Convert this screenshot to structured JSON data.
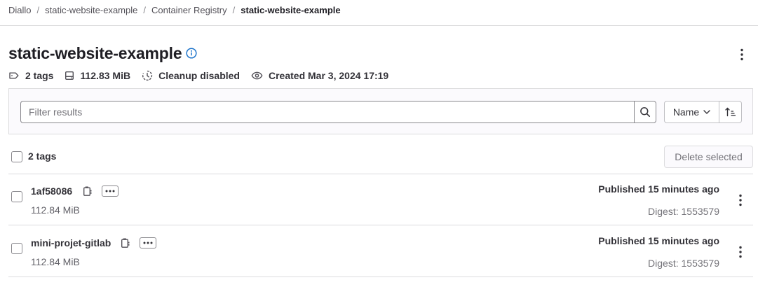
{
  "breadcrumb": {
    "items": [
      "Diallo",
      "static-website-example",
      "Container Registry"
    ],
    "separator": "/",
    "current": "static-website-example"
  },
  "header": {
    "title": "static-website-example",
    "info_icon": "info-icon",
    "actions_icon": "vertical-ellipsis-icon"
  },
  "meta": {
    "tags": "2 tags",
    "size": "112.83 MiB",
    "cleanup": "Cleanup disabled",
    "created": "Created Mar 3, 2024 17:19"
  },
  "filter": {
    "placeholder": "Filter results",
    "value": "",
    "sort_field": "Name"
  },
  "list": {
    "select_all_label": "2 tags",
    "delete_selected_label": "Delete selected",
    "rows": [
      {
        "name": "1af58086",
        "size": "112.84 MiB",
        "published": "Published 15 minutes ago",
        "digest": "Digest: 1553579"
      },
      {
        "name": "mini-projet-gitlab",
        "size": "112.84 MiB",
        "published": "Published 15 minutes ago",
        "digest": "Digest: 1553579"
      }
    ]
  },
  "colors": {
    "info_icon": "#1f75cb",
    "border": "#dcdcde",
    "text": "#333238",
    "muted": "#737278"
  }
}
